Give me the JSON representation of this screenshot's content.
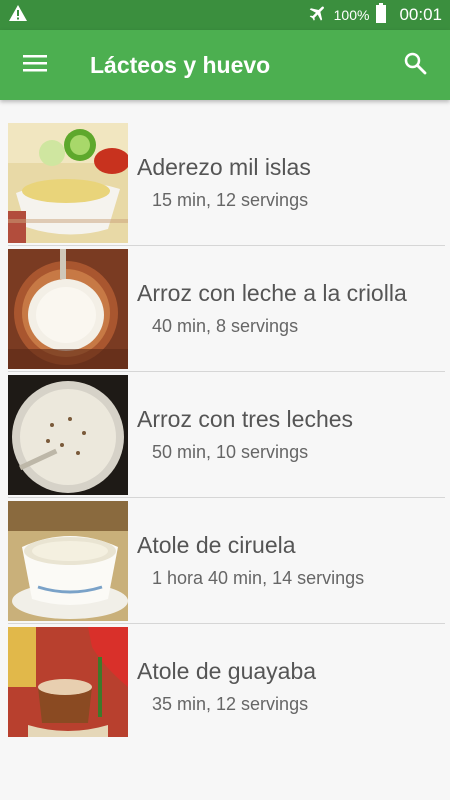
{
  "status_bar": {
    "battery": "100%",
    "time": "00:01",
    "icons": [
      "warning-icon",
      "airplane-mode-icon",
      "battery-icon"
    ]
  },
  "app_bar": {
    "title": "Lácteos y huevo",
    "icons": [
      "menu-icon",
      "search-icon"
    ]
  },
  "recipes": [
    {
      "name": "Aderezo mil islas",
      "meta": "15 min, 12 servings"
    },
    {
      "name": "Arroz con leche a la criolla",
      "meta": "40 min, 8 servings"
    },
    {
      "name": "Arroz con tres leches",
      "meta": "50 min, 10 servings"
    },
    {
      "name": "Atole de ciruela",
      "meta": "1 hora 40 min, 14 servings"
    },
    {
      "name": "Atole de guayaba",
      "meta": "35 min, 12 servings"
    }
  ],
  "colors": {
    "status_bar": "#3b8f3e",
    "app_bar": "#4caf50",
    "background": "#f7f7f7"
  }
}
